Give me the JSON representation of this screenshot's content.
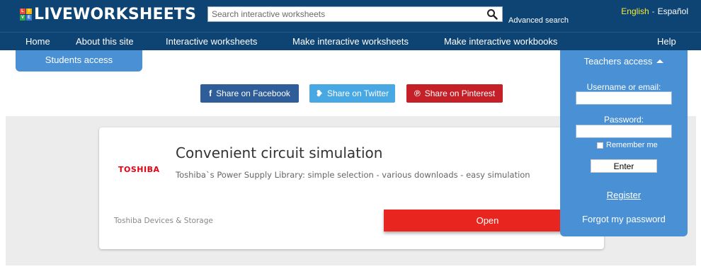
{
  "header": {
    "logo_tiles": [
      "L",
      "I",
      "V",
      "E"
    ],
    "logo_text": "LIVEWORKSHEETS",
    "search_placeholder": "Search interactive worksheets",
    "advanced_search": "Advanced search",
    "lang_english": "English",
    "lang_separator": "-",
    "lang_spanish": "Español"
  },
  "nav": {
    "items": [
      "Home",
      "About this site",
      "Interactive worksheets",
      "Make interactive worksheets",
      "Make interactive workbooks",
      "Help"
    ]
  },
  "students_access": "Students access",
  "share": {
    "facebook_glyph": "f",
    "facebook": "Share on Facebook",
    "twitter_glyph": "❥",
    "twitter": "Share on Twitter",
    "pinterest_glyph": "℗",
    "pinterest": "Share on Pinterest"
  },
  "ad": {
    "logo": "TOSHIBA",
    "title": "Convenient circuit simulation",
    "description": "Toshiba`s Power Supply Library: simple selection - various downloads - easy simulation",
    "advertiser": "Toshiba Devices & Storage",
    "cta": "Open"
  },
  "teachers": {
    "heading": "Teachers access",
    "username_label": "Username or email:",
    "password_label": "Password:",
    "remember_me": "Remember me",
    "enter": "Enter",
    "register": "Register",
    "forgot": "Forgot my password"
  },
  "colors": {
    "header_bg": "#0e4473",
    "panel_blue": "#4a90d4",
    "facebook": "#2f5d99",
    "twitter": "#48a8e3",
    "pinterest": "#c51f28",
    "ad_cta": "#e8261f",
    "language_active": "#f4ea3a",
    "logo_tiles": [
      "#e94b3c",
      "#f7b500",
      "#2ea44f",
      "#3b7dd8"
    ]
  }
}
